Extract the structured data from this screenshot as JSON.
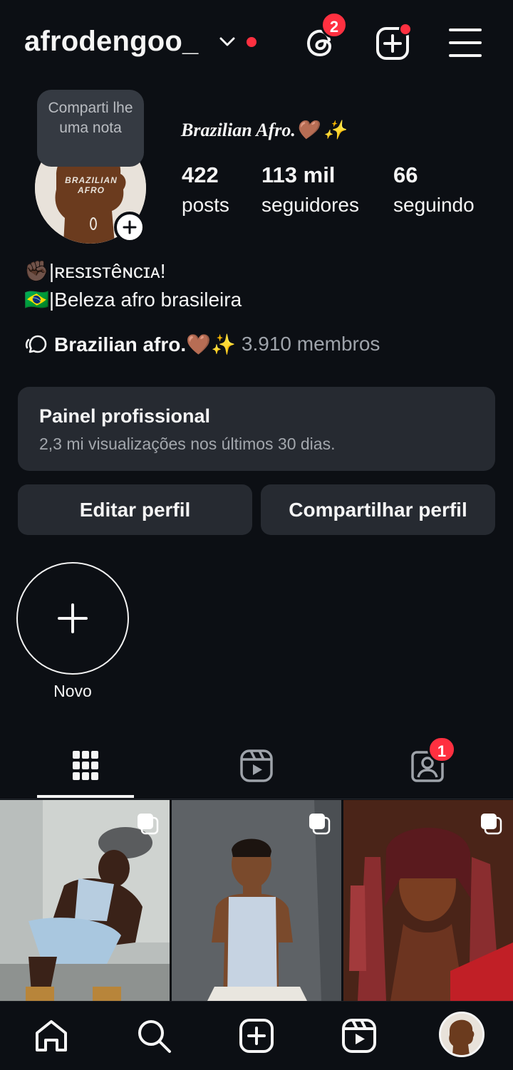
{
  "header": {
    "username": "afrodengoo_",
    "threads_badge": "2"
  },
  "profile": {
    "note_text": "Comparti lhe uma nota",
    "avatar_text_1": "BRAZILIAN",
    "avatar_text_2": "AFRO",
    "display_name": "Brazilian Afro.🤎 ✨",
    "stats": [
      {
        "value": "422",
        "label": "posts"
      },
      {
        "value": "113 mil",
        "label": "seguidores"
      },
      {
        "value": "66",
        "label": "seguindo"
      }
    ],
    "bio_line_1": "✊🏿|ʀᴇsɪsᴛêɴᴄɪᴀ!",
    "bio_line_2": "🇧🇷|Beleza afro brasileira",
    "channel_name": "Brazilian afro.🤎✨",
    "channel_members": "3.910 membros"
  },
  "dashboard": {
    "title": "Painel profissional",
    "subtitle": "2,3 mi visualizações nos últimos 30 dias."
  },
  "actions": {
    "edit": "Editar perfil",
    "share": "Compartilhar perfil"
  },
  "highlight": {
    "new_label": "Novo"
  },
  "tabs": {
    "tagged_badge": "1"
  },
  "colors": {
    "background": "#0c0f14",
    "surface": "#262a31",
    "badge": "#ff3040",
    "avatar_brown": "#6b3b1e"
  }
}
